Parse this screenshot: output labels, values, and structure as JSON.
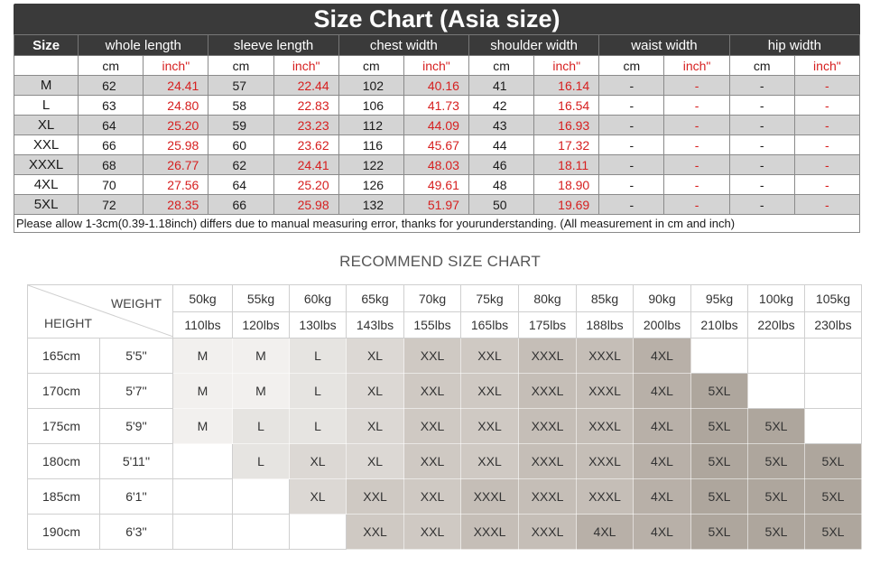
{
  "size_chart": {
    "title": "Size Chart (Asia size)",
    "header": {
      "size": "Size",
      "columns": [
        "whole length",
        "sleeve length",
        "chest width",
        "shoulder width",
        "waist width",
        "hip width"
      ]
    },
    "units": {
      "cm": "cm",
      "inch": "inch\""
    },
    "rows": [
      {
        "size": "M",
        "vals": [
          [
            "62",
            "24.41"
          ],
          [
            "57",
            "22.44"
          ],
          [
            "102",
            "40.16"
          ],
          [
            "41",
            "16.14"
          ],
          [
            "-",
            "-"
          ],
          [
            "-",
            "-"
          ]
        ]
      },
      {
        "size": "L",
        "vals": [
          [
            "63",
            "24.80"
          ],
          [
            "58",
            "22.83"
          ],
          [
            "106",
            "41.73"
          ],
          [
            "42",
            "16.54"
          ],
          [
            "-",
            "-"
          ],
          [
            "-",
            "-"
          ]
        ]
      },
      {
        "size": "XL",
        "vals": [
          [
            "64",
            "25.20"
          ],
          [
            "59",
            "23.23"
          ],
          [
            "112",
            "44.09"
          ],
          [
            "43",
            "16.93"
          ],
          [
            "-",
            "-"
          ],
          [
            "-",
            "-"
          ]
        ]
      },
      {
        "size": "XXL",
        "vals": [
          [
            "66",
            "25.98"
          ],
          [
            "60",
            "23.62"
          ],
          [
            "116",
            "45.67"
          ],
          [
            "44",
            "17.32"
          ],
          [
            "-",
            "-"
          ],
          [
            "-",
            "-"
          ]
        ]
      },
      {
        "size": "XXXL",
        "vals": [
          [
            "68",
            "26.77"
          ],
          [
            "62",
            "24.41"
          ],
          [
            "122",
            "48.03"
          ],
          [
            "46",
            "18.11"
          ],
          [
            "-",
            "-"
          ],
          [
            "-",
            "-"
          ]
        ]
      },
      {
        "size": "4XL",
        "vals": [
          [
            "70",
            "27.56"
          ],
          [
            "64",
            "25.20"
          ],
          [
            "126",
            "49.61"
          ],
          [
            "48",
            "18.90"
          ],
          [
            "-",
            "-"
          ],
          [
            "-",
            "-"
          ]
        ]
      },
      {
        "size": "5XL",
        "vals": [
          [
            "72",
            "28.35"
          ],
          [
            "66",
            "25.98"
          ],
          [
            "132",
            "51.97"
          ],
          [
            "50",
            "19.69"
          ],
          [
            "-",
            "-"
          ],
          [
            "-",
            "-"
          ]
        ]
      }
    ],
    "note": "Please allow 1-3cm(0.39-1.18inch) differs due to manual measuring error, thanks for yourunderstanding. (All measurement in cm and inch)"
  },
  "recommend_chart": {
    "title": "RECOMMEND SIZE CHART",
    "corner": {
      "weight": "WEIGHT",
      "height": "HEIGHT"
    },
    "weights_kg": [
      "50kg",
      "55kg",
      "60kg",
      "65kg",
      "70kg",
      "75kg",
      "80kg",
      "85kg",
      "90kg",
      "95kg",
      "100kg",
      "105kg"
    ],
    "weights_lbs": [
      "110lbs",
      "120lbs",
      "130lbs",
      "143lbs",
      "155lbs",
      "165lbs",
      "175lbs",
      "188lbs",
      "200lbs",
      "210lbs",
      "220lbs",
      "230lbs"
    ],
    "rows": [
      {
        "cm": "165cm",
        "ft": "5'5''",
        "cells": [
          "M",
          "M",
          "L",
          "XL",
          "XXL",
          "XXL",
          "XXXL",
          "XXXL",
          "4XL",
          "",
          "",
          ""
        ]
      },
      {
        "cm": "170cm",
        "ft": "5'7''",
        "cells": [
          "M",
          "M",
          "L",
          "XL",
          "XXL",
          "XXL",
          "XXXL",
          "XXXL",
          "4XL",
          "5XL",
          "",
          ""
        ]
      },
      {
        "cm": "175cm",
        "ft": "5'9''",
        "cells": [
          "M",
          "L",
          "L",
          "XL",
          "XXL",
          "XXL",
          "XXXL",
          "XXXL",
          "4XL",
          "5XL",
          "5XL",
          ""
        ]
      },
      {
        "cm": "180cm",
        "ft": "5'11''",
        "cells": [
          "",
          "L",
          "XL",
          "XL",
          "XXL",
          "XXL",
          "XXXL",
          "XXXL",
          "4XL",
          "5XL",
          "5XL",
          "5XL"
        ]
      },
      {
        "cm": "185cm",
        "ft": "6'1''",
        "cells": [
          "",
          "",
          "XL",
          "XXL",
          "XXL",
          "XXXL",
          "XXXL",
          "XXXL",
          "4XL",
          "5XL",
          "5XL",
          "5XL"
        ]
      },
      {
        "cm": "190cm",
        "ft": "6'3''",
        "cells": [
          "",
          "",
          "",
          "XXL",
          "XXL",
          "XXXL",
          "XXXL",
          "4XL",
          "4XL",
          "5XL",
          "5XL",
          "5XL"
        ]
      }
    ],
    "shade_colors": {
      "M": "#f2f0ee",
      "L": "#e6e4e1",
      "XL": "#dcd8d4",
      "XXL": "#cfc9c3",
      "XXXL": "#c5beb7",
      "4XL": "#b8b0a8",
      "5XL": "#aea69d",
      "": "#ffffff"
    }
  }
}
